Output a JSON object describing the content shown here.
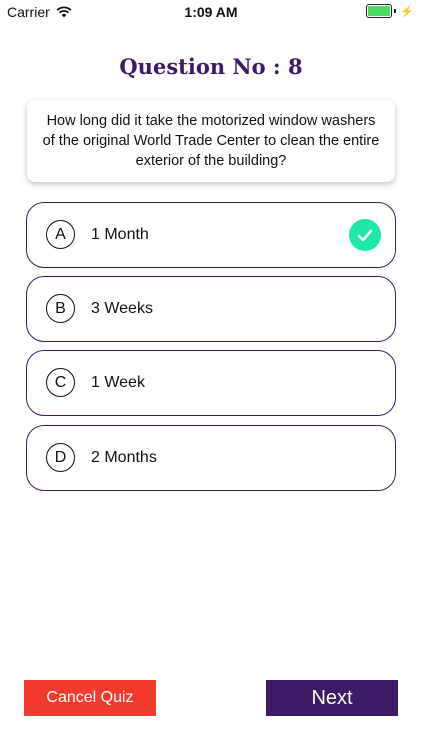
{
  "status_bar": {
    "carrier": "Carrier",
    "time": "1:09 AM",
    "battery_color": "#4cd964"
  },
  "quiz": {
    "title": "Question No : 8",
    "question": "How long did it take the motorized window washers of the original World Trade Center to clean the entire exterior of the building?",
    "options": [
      {
        "letter": "A",
        "text": "1 Month",
        "selected": true
      },
      {
        "letter": "B",
        "text": "3 Weeks",
        "selected": false
      },
      {
        "letter": "C",
        "text": "1 Week",
        "selected": false
      },
      {
        "letter": "D",
        "text": "2 Months",
        "selected": false
      }
    ],
    "selected_icon": "check-icon"
  },
  "actions": {
    "cancel_label": "Cancel Quiz",
    "next_label": "Next"
  },
  "colors": {
    "accent": "#3d1a66",
    "cancel": "#f23b2e",
    "check": "#1ee8a8"
  }
}
